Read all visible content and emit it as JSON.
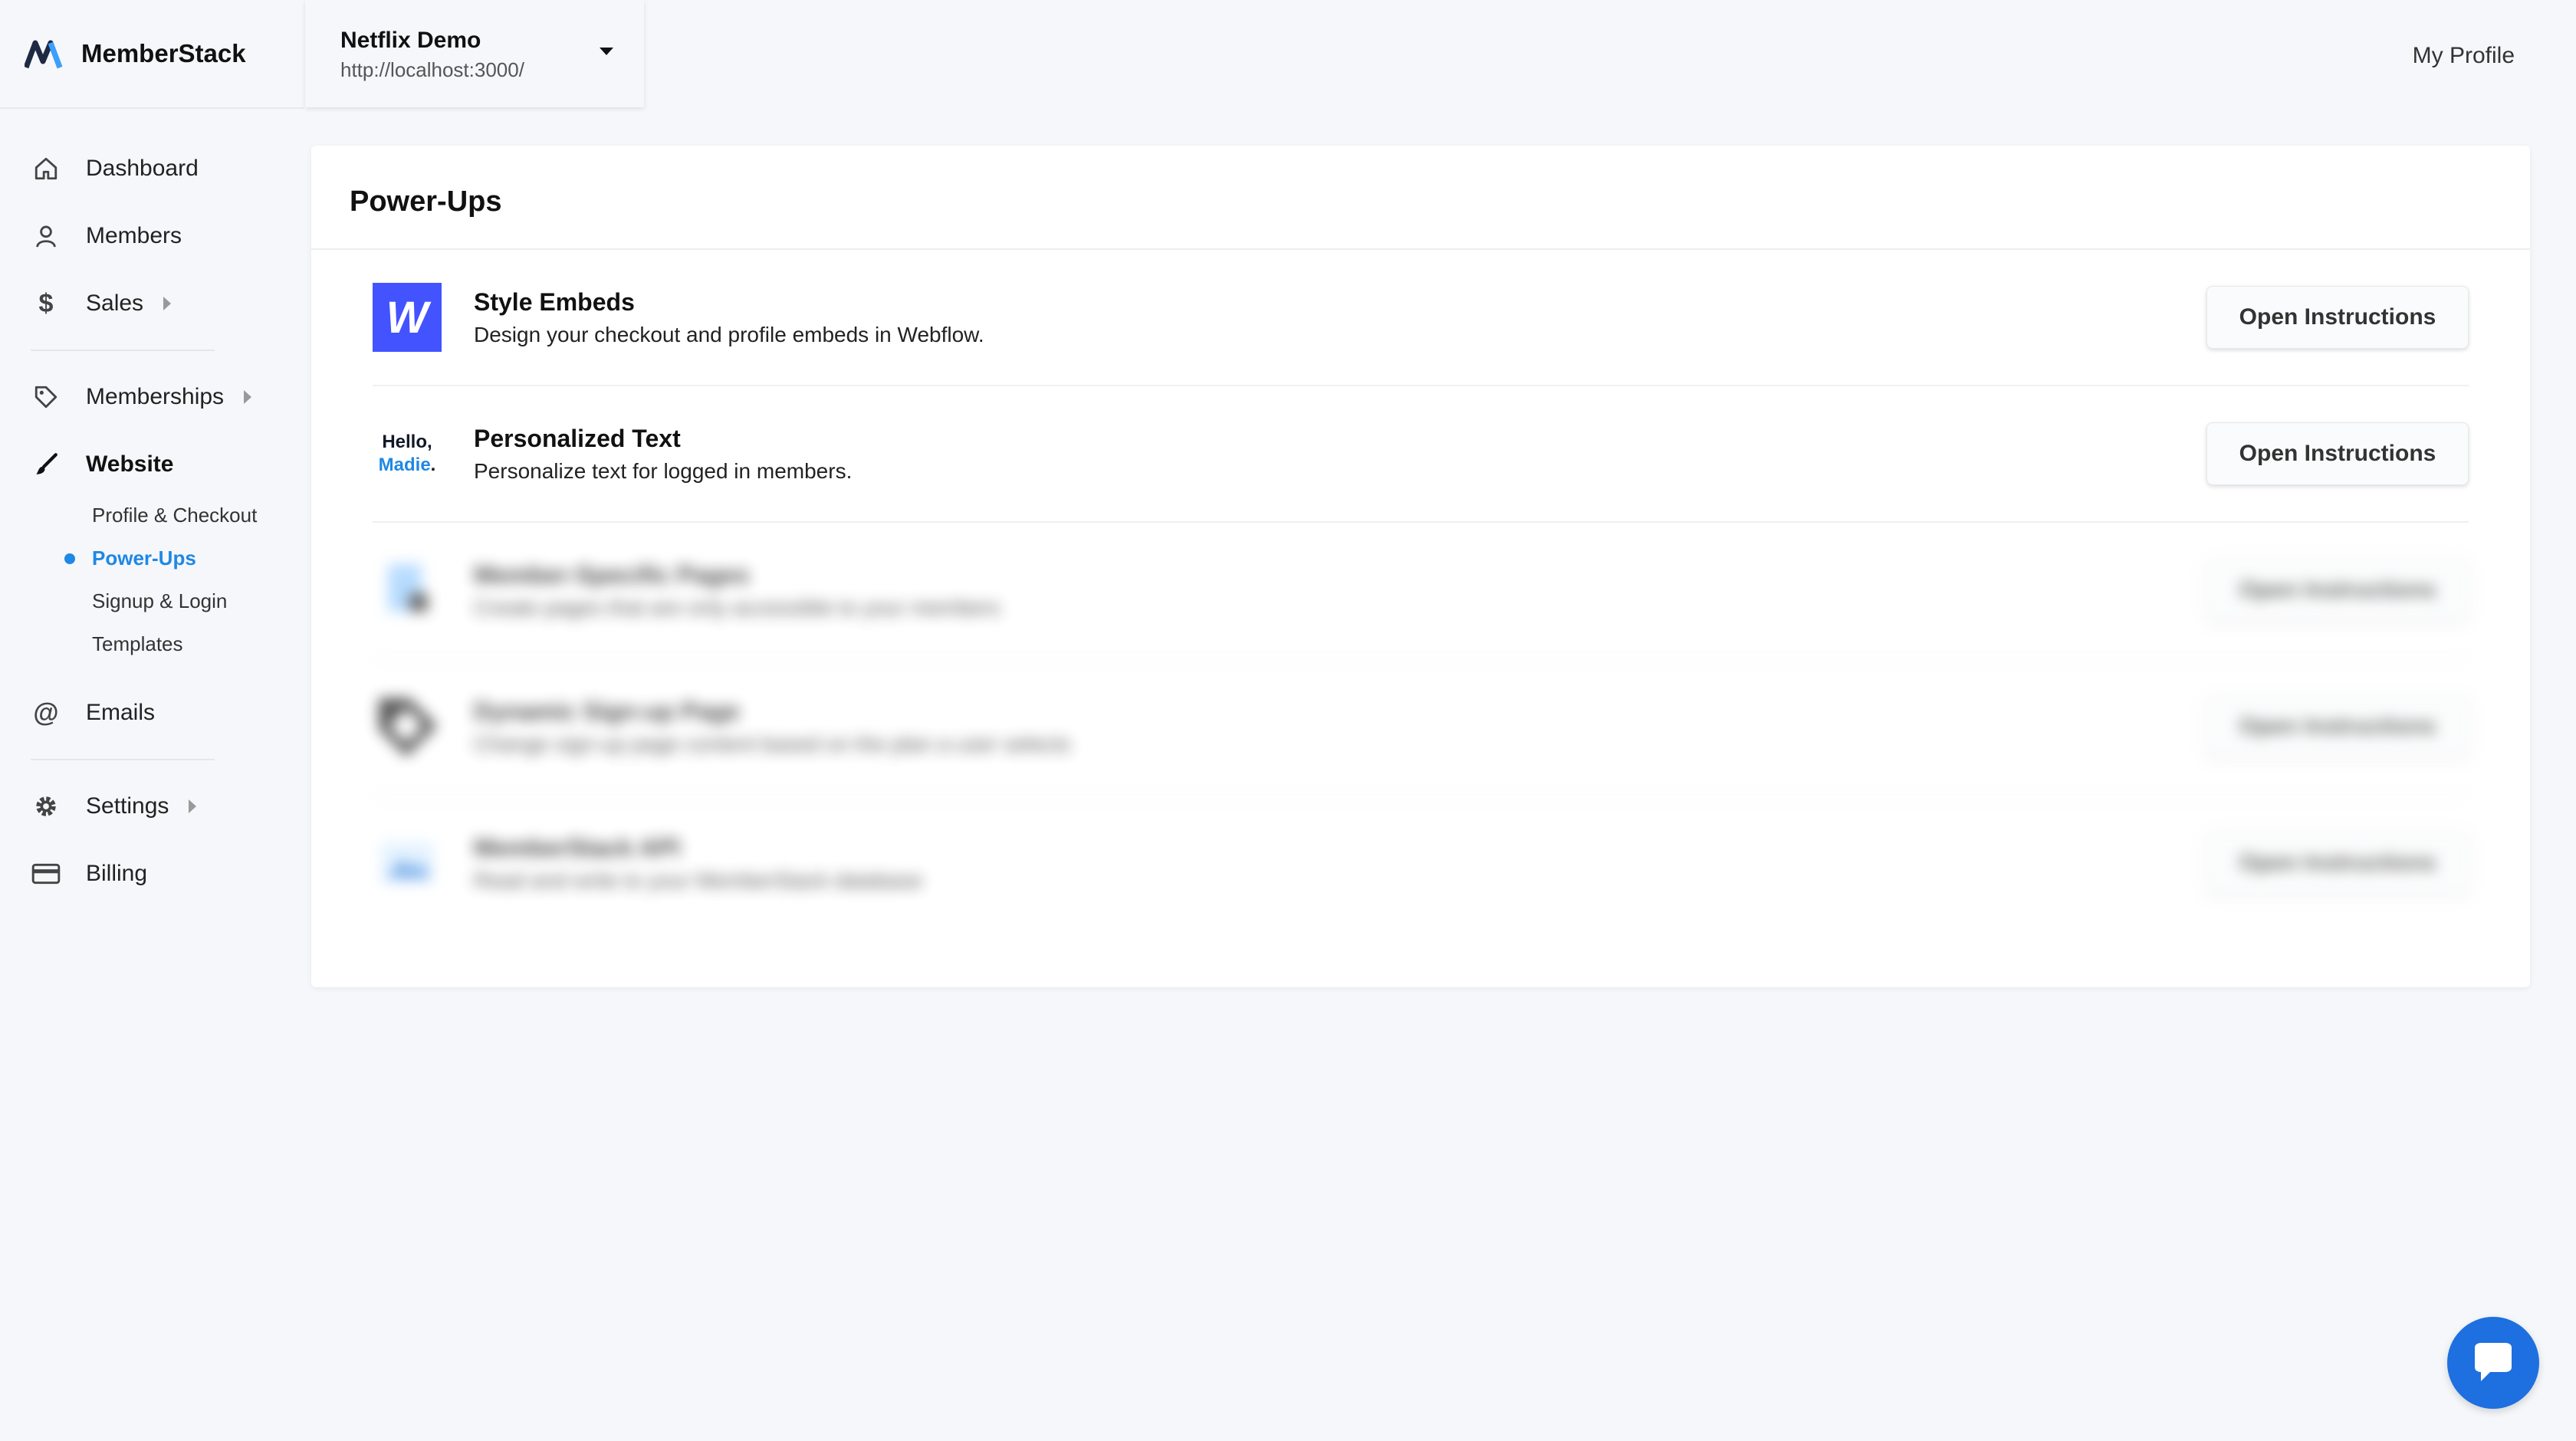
{
  "brand": {
    "name": "MemberStack"
  },
  "project": {
    "name": "Netflix Demo",
    "url": "http://localhost:3000/"
  },
  "header": {
    "profile_link": "My Profile"
  },
  "sidebar": {
    "items": [
      {
        "label": "Dashboard",
        "icon": "home-icon"
      },
      {
        "label": "Members",
        "icon": "user-icon"
      },
      {
        "label": "Sales",
        "icon": "dollar-icon"
      },
      {
        "label": "Memberships",
        "icon": "tag-icon"
      },
      {
        "label": "Website",
        "icon": "brush-icon"
      },
      {
        "label": "Emails",
        "icon": "at-icon"
      },
      {
        "label": "Settings",
        "icon": "gear-icon"
      },
      {
        "label": "Billing",
        "icon": "credit-card-icon"
      }
    ],
    "website_subitems": [
      "Profile & Checkout",
      "Power-Ups",
      "Signup & Login",
      "Templates"
    ],
    "active_subitem": "Power-Ups"
  },
  "main": {
    "title": "Power-Ups",
    "powerups": [
      {
        "title": "Style Embeds",
        "description": "Design your checkout and profile embeds in Webflow.",
        "button": "Open Instructions",
        "icon": "webflow-icon",
        "icon_text": "W"
      },
      {
        "title": "Personalized Text",
        "description": "Personalize text for logged in members.",
        "button": "Open Instructions",
        "icon": "hello-name-icon",
        "icon_line1": "Hello,",
        "icon_line2": "Madie",
        "icon_dot": "."
      },
      {
        "title": "Member-Specific Pages",
        "description": "Create pages that are only accessible to your members",
        "button": "Open Instructions",
        "icon": "page-lock-icon"
      },
      {
        "title": "Dynamic Sign-up Page",
        "description": "Change sign-up page content based on the plan a user selects",
        "button": "Open Instructions",
        "icon": "tag-dynamic-icon"
      },
      {
        "title": "MemberStack API",
        "description": "Read and write to your MemberStack database",
        "button": "Open Instructions",
        "icon": "api-image-icon"
      }
    ]
  },
  "colors": {
    "accent": "#1e88e5",
    "webflow": "#4353ff",
    "chat": "#1e6fe0"
  }
}
